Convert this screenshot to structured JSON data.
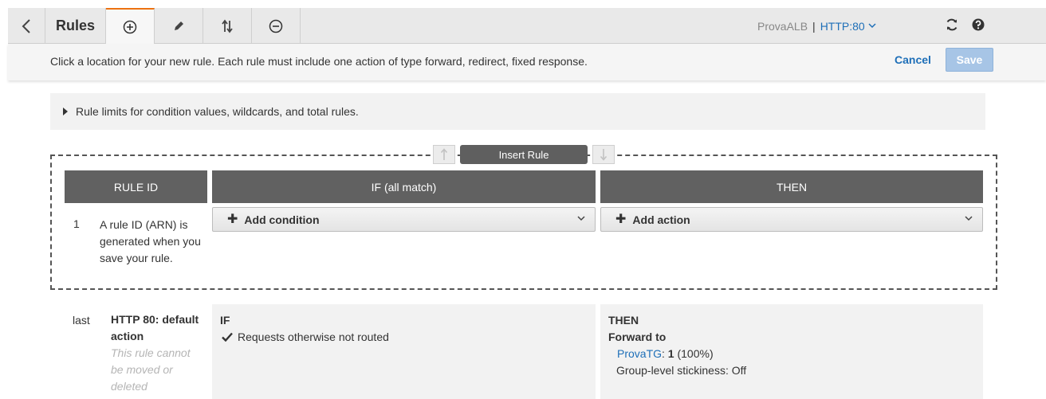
{
  "toolbar": {
    "back_icon": "chevron-left-icon",
    "title": "Rules",
    "tools": [
      {
        "name": "add",
        "icon": "plus-circle-icon",
        "active": true
      },
      {
        "name": "edit",
        "icon": "pencil-icon"
      },
      {
        "name": "reorder",
        "icon": "up-down-arrows-icon"
      },
      {
        "name": "delete",
        "icon": "minus-circle-icon"
      }
    ],
    "load_balancer": "ProvaALB",
    "separator": "|",
    "listener": "HTTP:80",
    "refresh_icon": "refresh-icon",
    "help_icon": "help-icon"
  },
  "instruction": {
    "text": "Click a location for your new rule. Each rule must include one action of type forward, redirect, fixed response.",
    "cancel_label": "Cancel",
    "save_label": "Save"
  },
  "limits": {
    "text": "Rule limits for condition values, wildcards, and total rules."
  },
  "insert": {
    "label": "Insert Rule",
    "up_icon": "arrow-up-icon",
    "down_icon": "arrow-down-icon"
  },
  "columns": {
    "rule_id": "RULE ID",
    "if": "IF (all match)",
    "then": "THEN"
  },
  "new_rule": {
    "number": "1",
    "id_text": "A rule ID (ARN) is generated when you save your rule.",
    "add_condition_label": "Add condition",
    "add_action_label": "Add action"
  },
  "default_rule": {
    "position": "last",
    "title": "HTTP 80: default action",
    "note": "This rule cannot be moved or deleted",
    "if_heading": "IF",
    "if_condition": "Requests otherwise not routed",
    "then_heading": "THEN",
    "forward_label": "Forward to",
    "target_group": "ProvaTG",
    "target_colon": ":",
    "weight": "1",
    "weight_pct": "(100%)",
    "stickiness": "Group-level stickiness: Off"
  },
  "colors": {
    "accent_tab": "#ec7211",
    "link": "#1e6fb8",
    "header_bg": "#616161",
    "save_disabled": "#a7c5e6"
  }
}
